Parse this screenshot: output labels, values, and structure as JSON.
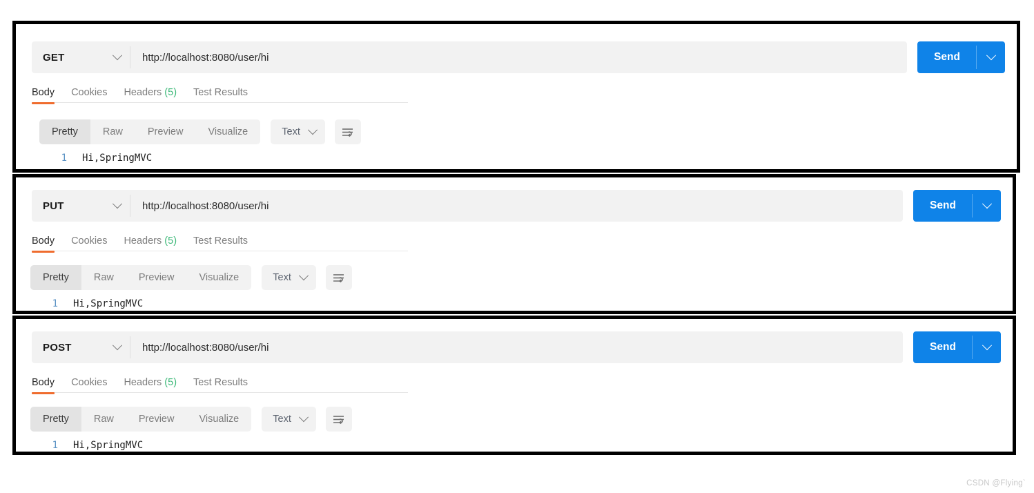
{
  "watermark": "CSDN @Flying`",
  "icons": {
    "chevron_down": "chevron-down-icon",
    "wrap_lines": "wrap-lines-icon"
  },
  "colors": {
    "send_blue": "#0f83e8",
    "tab_underline_orange": "#ef6c2e",
    "headers_count_green": "#3cb878",
    "field_gray": "#f2f2f2",
    "linenumber_blue": "#5b92c4"
  },
  "panels": [
    {
      "request": {
        "method": "GET",
        "url": "http://localhost:8080/user/hi",
        "send_label": "Send"
      },
      "response_tabs": [
        {
          "label": "Body",
          "active": true
        },
        {
          "label": "Cookies",
          "active": false
        },
        {
          "label": "Headers",
          "count": "(5)",
          "active": false
        },
        {
          "label": "Test Results",
          "active": false
        }
      ],
      "format_bar": {
        "segments": [
          {
            "label": "Pretty",
            "active": true
          },
          {
            "label": "Raw",
            "active": false
          },
          {
            "label": "Preview",
            "active": false
          },
          {
            "label": "Visualize",
            "active": false
          }
        ],
        "type_label": "Text"
      },
      "body": {
        "line_number": "1",
        "content": "Hi,SpringMVC"
      }
    },
    {
      "request": {
        "method": "PUT",
        "url": "http://localhost:8080/user/hi",
        "send_label": "Send"
      },
      "response_tabs": [
        {
          "label": "Body",
          "active": true
        },
        {
          "label": "Cookies",
          "active": false
        },
        {
          "label": "Headers",
          "count": "(5)",
          "active": false
        },
        {
          "label": "Test Results",
          "active": false
        }
      ],
      "format_bar": {
        "segments": [
          {
            "label": "Pretty",
            "active": true
          },
          {
            "label": "Raw",
            "active": false
          },
          {
            "label": "Preview",
            "active": false
          },
          {
            "label": "Visualize",
            "active": false
          }
        ],
        "type_label": "Text"
      },
      "body": {
        "line_number": "1",
        "content": "Hi,SpringMVC"
      }
    },
    {
      "request": {
        "method": "POST",
        "url": "http://localhost:8080/user/hi",
        "send_label": "Send"
      },
      "response_tabs": [
        {
          "label": "Body",
          "active": true
        },
        {
          "label": "Cookies",
          "active": false
        },
        {
          "label": "Headers",
          "count": "(5)",
          "active": false
        },
        {
          "label": "Test Results",
          "active": false
        }
      ],
      "format_bar": {
        "segments": [
          {
            "label": "Pretty",
            "active": true
          },
          {
            "label": "Raw",
            "active": false
          },
          {
            "label": "Preview",
            "active": false
          },
          {
            "label": "Visualize",
            "active": false
          }
        ],
        "type_label": "Text"
      },
      "body": {
        "line_number": "1",
        "content": "Hi,SpringMVC"
      }
    }
  ]
}
